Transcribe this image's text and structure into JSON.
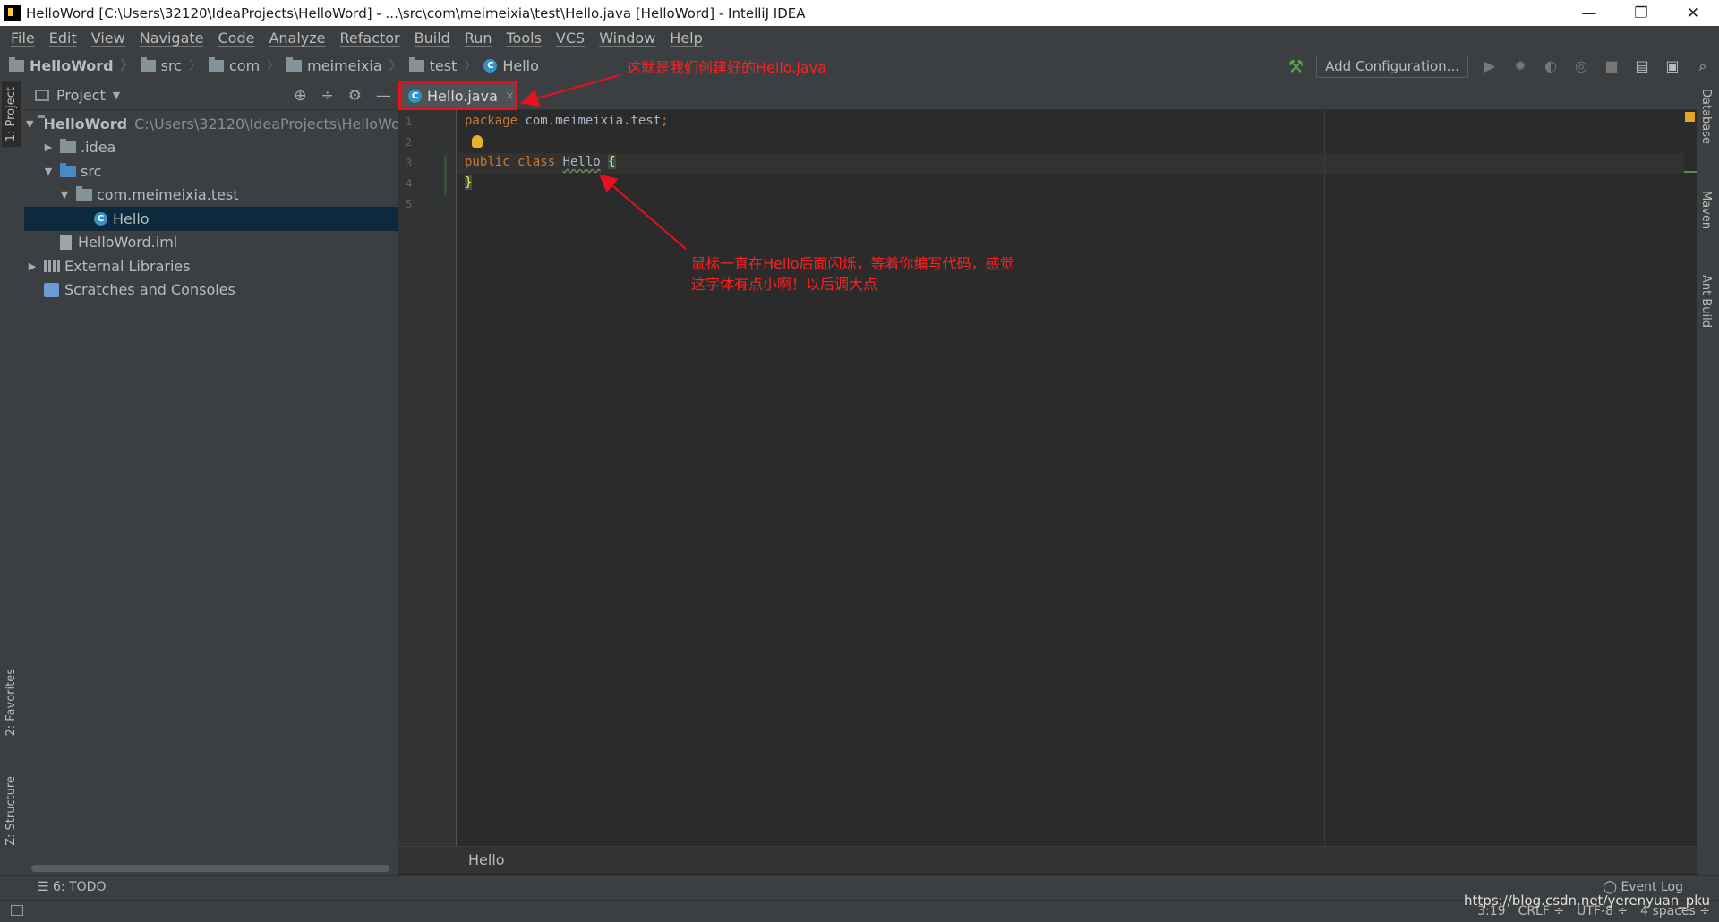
{
  "window": {
    "title": "HelloWord [C:\\Users\\32120\\IdeaProjects\\HelloWord] - ...\\src\\com\\meimeixia\\test\\Hello.java [HelloWord] - IntelliJ IDEA",
    "minimize": "—",
    "restore": "❐",
    "close": "✕"
  },
  "menu": [
    "File",
    "Edit",
    "View",
    "Navigate",
    "Code",
    "Analyze",
    "Refactor",
    "Build",
    "Run",
    "Tools",
    "VCS",
    "Window",
    "Help"
  ],
  "breadcrumbs": [
    "HelloWord",
    "src",
    "com",
    "meimeixia",
    "test",
    "Hello"
  ],
  "toolbar": {
    "add_configuration": "Add Configuration...",
    "hammer_icon": "⚒",
    "run_icon": "▶",
    "debug_icon": "✹",
    "coverage_icon": "◐",
    "profile_icon": "◎",
    "stop_icon": "■",
    "project_structure_icon": "▤",
    "layout_icon": "▣",
    "search_icon": "⌕"
  },
  "left_tabs": {
    "project": "1: Project",
    "favorites": "2: Favorites",
    "structure": "Z: Structure"
  },
  "project_panel": {
    "title": "Project",
    "caret": "▼",
    "locate_icon": "⊕",
    "collapse_icon": "÷",
    "settings_icon": "⚙",
    "hide_icon": "—",
    "tree": {
      "root_name": "HelloWord",
      "root_path": "C:\\Users\\32120\\IdeaProjects\\HelloWor",
      "idea": ".idea",
      "src": "src",
      "package": "com.meimeixia.test",
      "hello": "Hello",
      "iml": "HelloWord.iml",
      "external": "External Libraries",
      "scratches": "Scratches and Consoles"
    },
    "arrow_expanded": "▼",
    "arrow_collapsed": "▶"
  },
  "editor": {
    "tab_label": "Hello.java",
    "tab_close": "×",
    "line_numbers": [
      "1",
      "2",
      "3",
      "4",
      "5"
    ],
    "line1_keyword": "package",
    "line1_pkg": " com.meimeixia.test",
    "line1_semi": ";",
    "line3_keyword": "public class ",
    "line3_class": "Hello",
    "line3_brace": "{",
    "line4_brace": "}",
    "breadcrumb": "Hello"
  },
  "right_tabs": {
    "database": "Database",
    "maven": "Maven",
    "ant": "Ant Build"
  },
  "bottom": {
    "todo": "6: TODO",
    "event_log": "Event Log"
  },
  "status": {
    "position": "3:19",
    "line_sep": "CRLF ÷",
    "encoding": "UTF-8 ÷",
    "indent": "4 spaces ÷"
  },
  "watermark": "https://blog.csdn.net/yerenyuan_pku",
  "annotations": {
    "tab_note": "这就是我们创建好的Hello.java",
    "cursor_note_line1": "鼠标一直在Hello后面闪烁，等着你编写代码，感觉",
    "cursor_note_line2": "这字体有点小啊！以后调大点"
  },
  "colors": {
    "annotation_red": "#e8101c",
    "keyword_orange": "#cc7832",
    "brace_yellow": "#ffef28"
  }
}
